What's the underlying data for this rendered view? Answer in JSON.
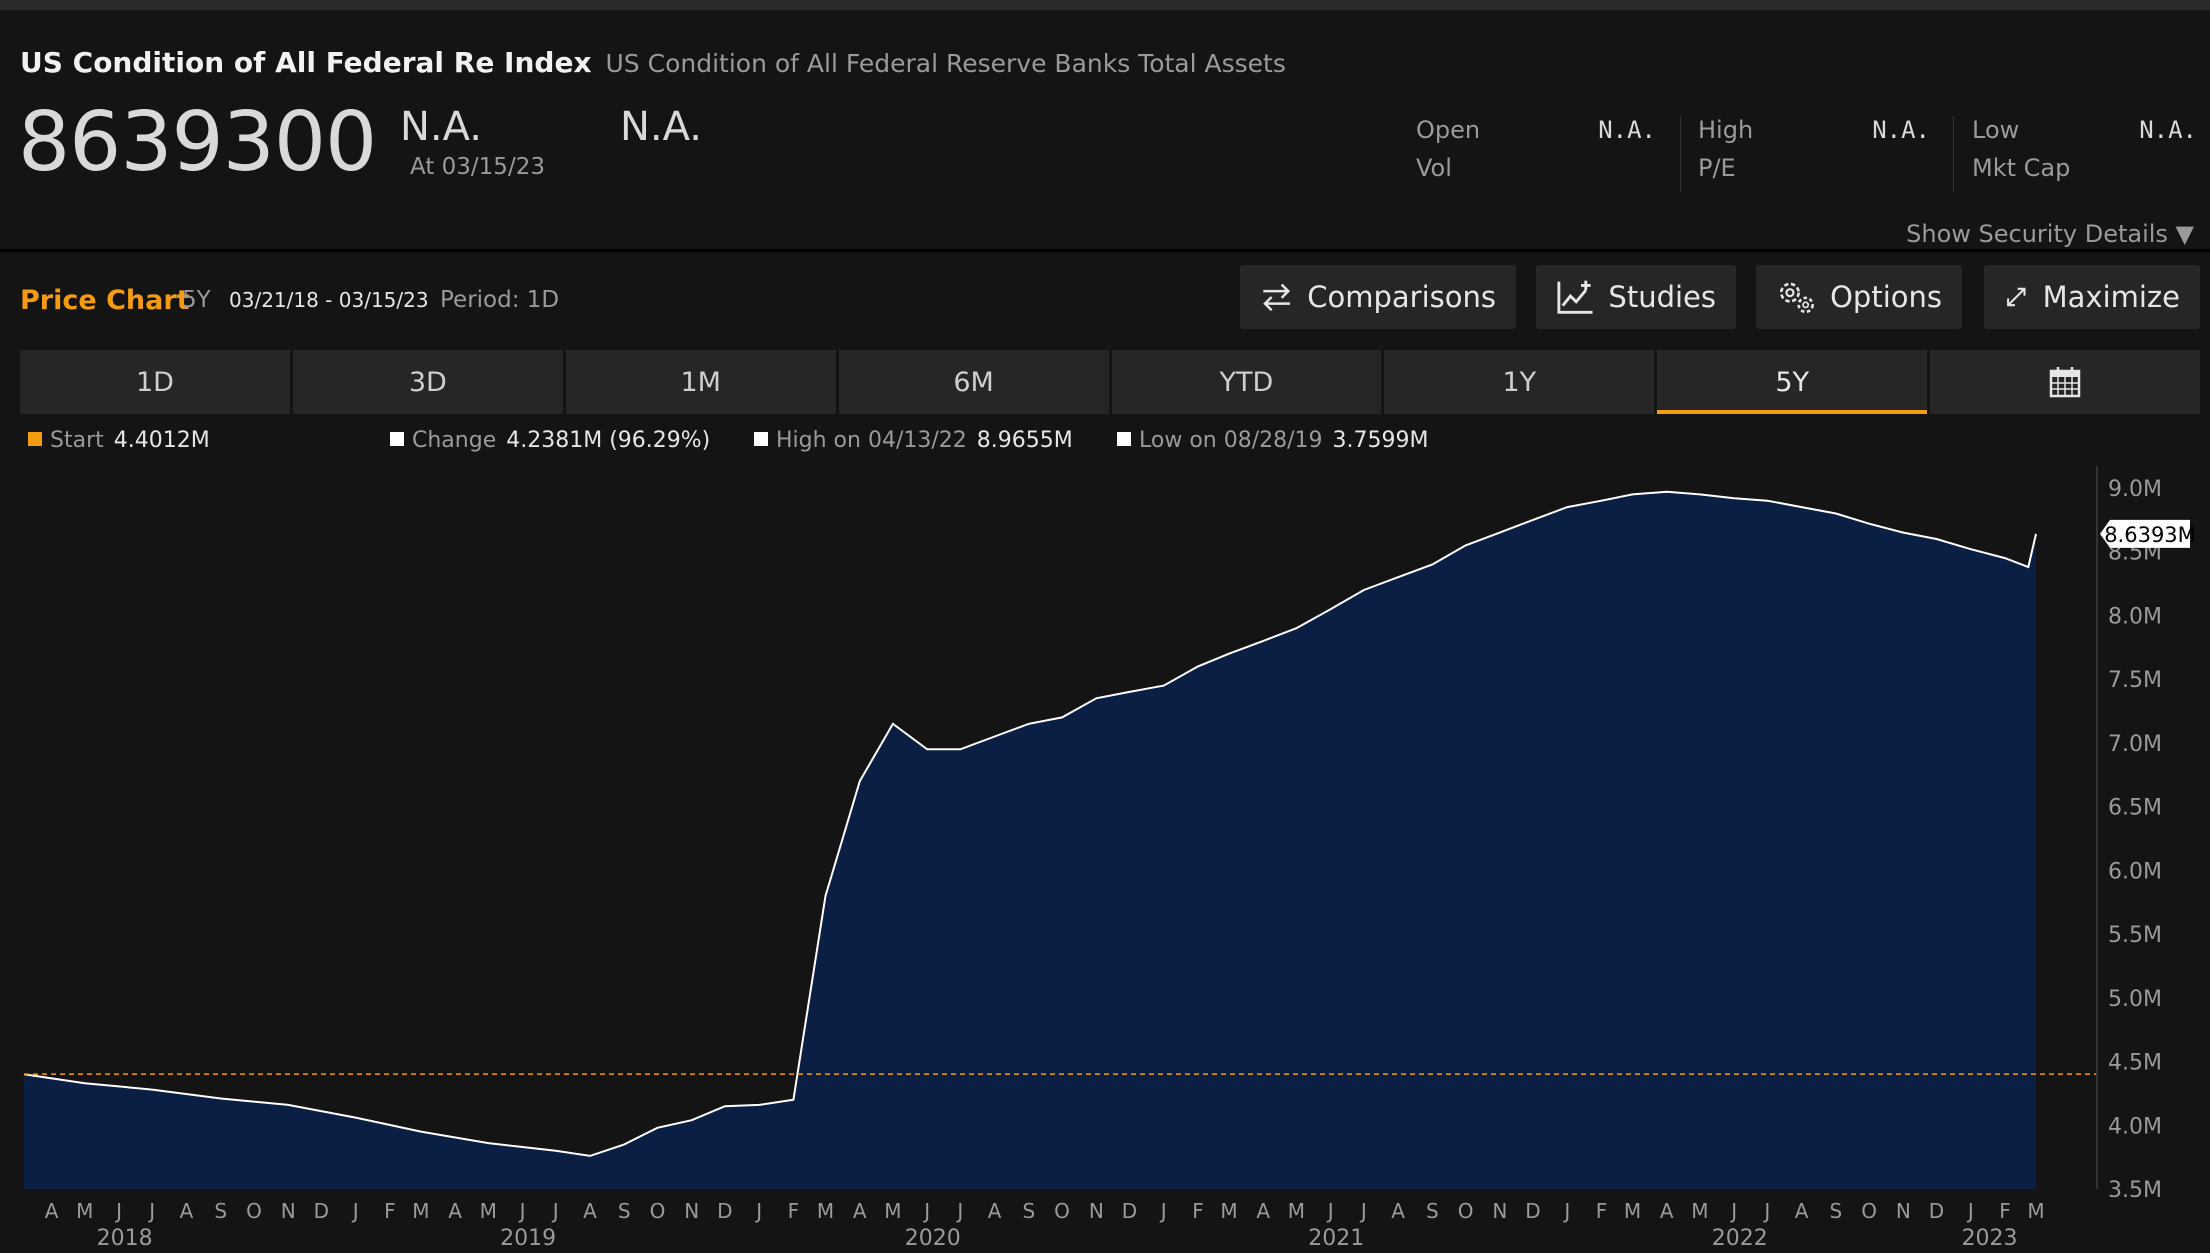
{
  "header": {
    "title": "US Condition of All Federal Re Index",
    "subtitle": "US Condition of All Federal Reserve Banks Total Assets",
    "price": "8639300",
    "change": "N.A.",
    "as_of": "At 03/15/23",
    "change_pct": "N.A.",
    "stats": [
      {
        "label": "Open",
        "value": "N.A."
      },
      {
        "label": "Vol",
        "value": ""
      },
      {
        "label": "High",
        "value": "N.A."
      },
      {
        "label": "P/E",
        "value": ""
      },
      {
        "label": "Low",
        "value": "N.A."
      },
      {
        "label": "Mkt Cap",
        "value": ""
      }
    ],
    "show_details": "Show Security Details ▼"
  },
  "toolbar": {
    "title": "Price Chart",
    "range": "5Y",
    "dates": "03/21/18 - 03/15/23",
    "period": "Period: 1D",
    "buttons": [
      "Comparisons",
      "Studies",
      "Options",
      "Maximize"
    ]
  },
  "tabs": [
    "1D",
    "3D",
    "1M",
    "6M",
    "YTD",
    "1Y",
    "5Y"
  ],
  "active_tab": "5Y",
  "legend": {
    "start_label": "Start",
    "start_value": "4.4012M",
    "change_label": "Change",
    "change_value": "4.2381M (96.29%)",
    "high_label": "High on 04/13/22",
    "high_value": "8.9655M",
    "low_label": "Low on 08/28/19",
    "low_value": "3.7599M"
  },
  "colors": {
    "accent": "#f39c12",
    "area_fill": "#0b1f44",
    "line": "#ffffff",
    "background": "#141414"
  },
  "icons": [
    "swap-arrows-icon",
    "chart-plus-icon",
    "gears-icon",
    "expand-icon",
    "calendar-icon"
  ],
  "chart_data": {
    "type": "area",
    "title": "",
    "xlabel": "",
    "ylabel": "",
    "ylim": [
      3.5,
      9.0
    ],
    "y_unit": "M",
    "y_ticks": [
      "3.5M",
      "4.0M",
      "4.5M",
      "5.0M",
      "5.5M",
      "6.0M",
      "6.5M",
      "7.0M",
      "7.5M",
      "8.0M",
      "8.5M",
      "9.0M"
    ],
    "x_ticks": [
      "A",
      "M",
      "J",
      "J",
      "A",
      "S",
      "O",
      "N",
      "D",
      "J",
      "F",
      "M",
      "A",
      "M",
      "J",
      "J",
      "A",
      "S",
      "O",
      "N",
      "D",
      "J",
      "F",
      "M",
      "A",
      "M",
      "J",
      "J",
      "A",
      "S",
      "O",
      "N",
      "D",
      "J",
      "F",
      "M",
      "A",
      "M",
      "J",
      "J",
      "A",
      "S",
      "O",
      "N",
      "D",
      "J",
      "F",
      "M",
      "A",
      "M",
      "J",
      "J",
      "A",
      "S",
      "O",
      "N",
      "D",
      "J",
      "F",
      "M"
    ],
    "year_labels": [
      "2018",
      "2019",
      "2020",
      "2021",
      "2022",
      "2023"
    ],
    "start_reference": 4.4012,
    "last_value_label": "8.6393M",
    "x": [
      "2018-03",
      "2018-05",
      "2018-07",
      "2018-09",
      "2018-11",
      "2019-01",
      "2019-03",
      "2019-05",
      "2019-07",
      "2019-08",
      "2019-09",
      "2019-10",
      "2019-11",
      "2019-12",
      "2020-01",
      "2020-02",
      "2020-03",
      "2020-04",
      "2020-05",
      "2020-06",
      "2020-07",
      "2020-08",
      "2020-09",
      "2020-10",
      "2020-11",
      "2020-12",
      "2021-01",
      "2021-02",
      "2021-03",
      "2021-04",
      "2021-05",
      "2021-06",
      "2021-07",
      "2021-08",
      "2021-09",
      "2021-10",
      "2021-11",
      "2021-12",
      "2022-01",
      "2022-02",
      "2022-03",
      "2022-04",
      "2022-05",
      "2022-06",
      "2022-07",
      "2022-08",
      "2022-09",
      "2022-10",
      "2022-11",
      "2022-12",
      "2023-01",
      "2023-02",
      "2023-03-08",
      "2023-03-15"
    ],
    "series": [
      {
        "values": [
          4.4,
          4.33,
          4.28,
          4.21,
          4.16,
          4.06,
          3.95,
          3.86,
          3.8,
          3.76,
          3.85,
          3.98,
          4.04,
          4.15,
          4.16,
          4.2,
          5.8,
          6.7,
          7.15,
          6.95,
          6.95,
          7.05,
          7.15,
          7.2,
          7.35,
          7.4,
          7.45,
          7.6,
          7.7,
          7.8,
          7.9,
          8.05,
          8.2,
          8.3,
          8.4,
          8.55,
          8.65,
          8.75,
          8.85,
          8.9,
          8.95,
          8.97,
          8.95,
          8.92,
          8.9,
          8.85,
          8.8,
          8.72,
          8.65,
          8.6,
          8.52,
          8.45,
          8.38,
          8.64
        ]
      }
    ]
  }
}
